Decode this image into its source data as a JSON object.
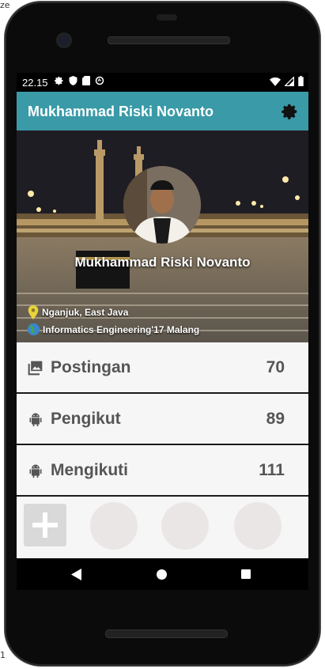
{
  "edge": {
    "top_left": "ze",
    "bottom_left": "1"
  },
  "status_bar": {
    "time": "22.15",
    "left_icons": [
      "settings-icon",
      "shield-icon",
      "sd-card-icon",
      "data-saver-icon"
    ],
    "right_icons": [
      "wifi-icon",
      "signal-icon",
      "battery-icon"
    ]
  },
  "app_bar": {
    "title": "Mukhammad Riski Novanto",
    "settings_icon": "gear-icon",
    "color": "#3a9aa7"
  },
  "profile": {
    "name": "Mukhammad Riski Novanto",
    "location": "Nganjuk, East Java",
    "education": "Informatics Engineering'17 Malang"
  },
  "stats": [
    {
      "icon": "image-icon",
      "label": "Postingan",
      "value": "70"
    },
    {
      "icon": "android-icon",
      "label": "Pengikut",
      "value": "89"
    },
    {
      "icon": "android-icon",
      "label": "Mengikuti",
      "value": "111"
    }
  ],
  "actions": {
    "add_icon": "plus-icon"
  },
  "nav_bar": {
    "back_icon": "back-triangle-icon",
    "home_icon": "home-circle-icon",
    "recents_icon": "recents-square-icon"
  }
}
